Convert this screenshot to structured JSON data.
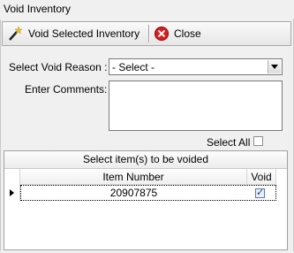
{
  "window": {
    "title": "Void Inventory"
  },
  "toolbar": {
    "void_label": "Void Selected Inventory",
    "close_label": "Close"
  },
  "form": {
    "reason_label": "Select Void Reason :",
    "reason_value": "- Select -",
    "comments_label": "Enter Comments:",
    "comments_value": "",
    "select_all_label": "Select All",
    "select_all_checked": false
  },
  "grid": {
    "title": "Select item(s) to be voided",
    "columns": [
      "Item Number",
      "Void"
    ],
    "rows": [
      {
        "item_number": "20907875",
        "void": true
      }
    ]
  }
}
